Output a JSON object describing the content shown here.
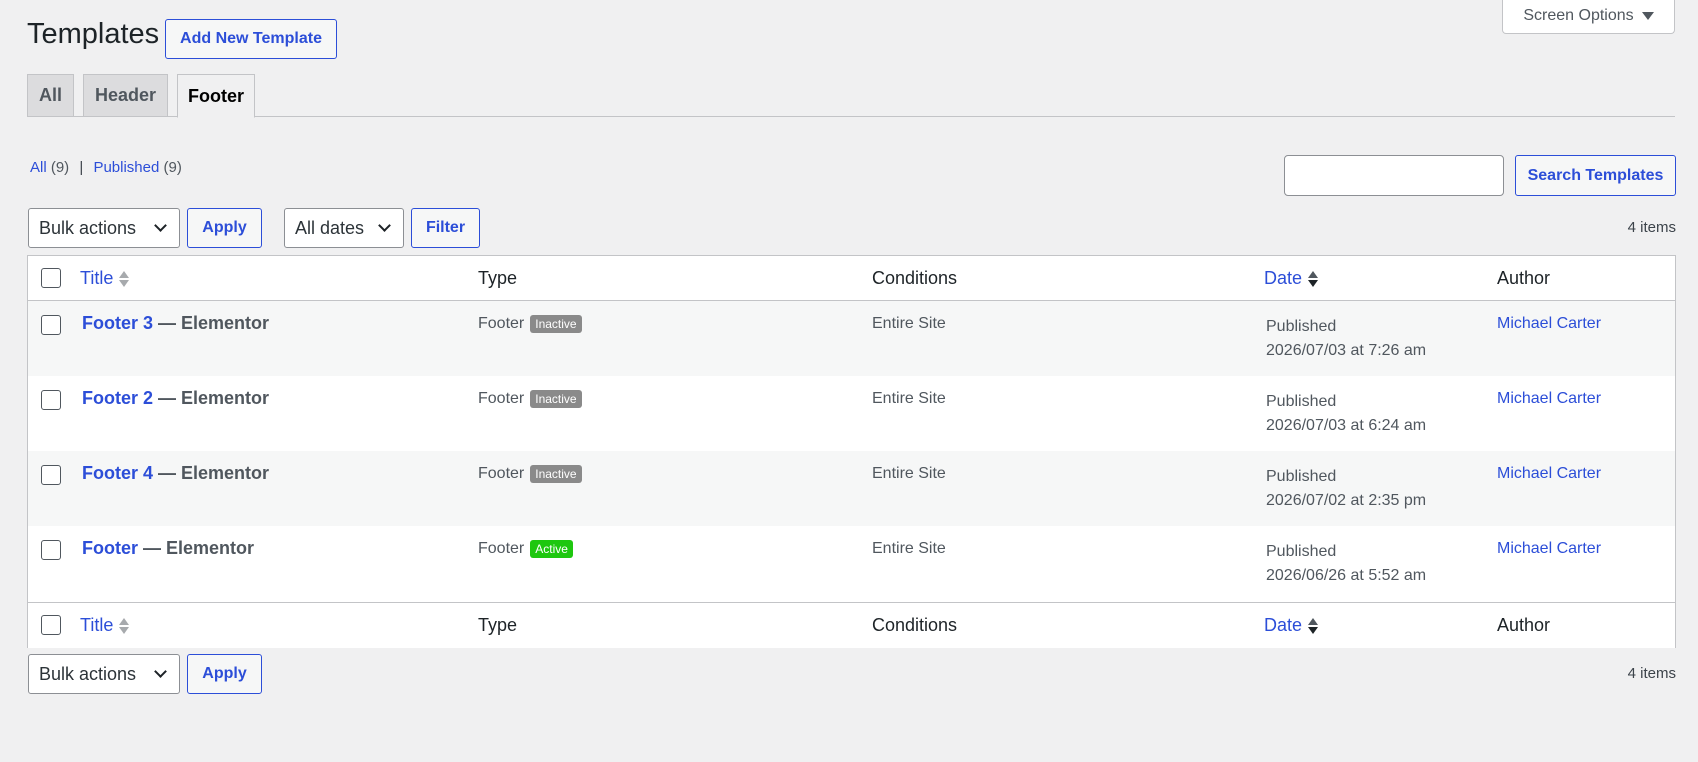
{
  "header": {
    "title": "Templates",
    "add_new_label": "Add New Template",
    "screen_options_label": "Screen Options"
  },
  "tabs": [
    {
      "label": "All",
      "active": false
    },
    {
      "label": "Header",
      "active": false
    },
    {
      "label": "Footer",
      "active": true
    }
  ],
  "views": {
    "all_label": "All",
    "all_count": "(9)",
    "published_label": "Published",
    "published_count": "(9)",
    "separator": "|"
  },
  "search": {
    "value": "",
    "button_label": "Search Templates"
  },
  "toolbar_top": {
    "bulk_actions": "Bulk actions",
    "apply_label": "Apply",
    "date_filter": "All dates",
    "filter_label": "Filter",
    "items_count": "4 items"
  },
  "toolbar_bottom": {
    "bulk_actions": "Bulk actions",
    "apply_label": "Apply",
    "items_count": "4 items"
  },
  "columns": {
    "title": "Title",
    "type": "Type",
    "conditions": "Conditions",
    "date": "Date",
    "author": "Author"
  },
  "rows": [
    {
      "title": "Footer 3",
      "suffix": " — Elementor",
      "type": "Footer",
      "status": "Inactive",
      "conditions": "Entire Site",
      "date_status": "Published",
      "date": "2026/07/03 at 7:26 am",
      "author": "Michael Carter"
    },
    {
      "title": "Footer 2",
      "suffix": " — Elementor",
      "type": "Footer",
      "status": "Inactive",
      "conditions": "Entire Site",
      "date_status": "Published",
      "date": "2026/07/03 at 6:24 am",
      "author": "Michael Carter"
    },
    {
      "title": "Footer 4",
      "suffix": " — Elementor",
      "type": "Footer",
      "status": "Inactive",
      "conditions": "Entire Site",
      "date_status": "Published",
      "date": "2026/07/02 at 2:35 pm",
      "author": "Michael Carter"
    },
    {
      "title": "Footer",
      "suffix": " — Elementor",
      "type": "Footer",
      "status": "Active",
      "conditions": "Entire Site",
      "date_status": "Published",
      "date": "2026/06/26 at 5:52 am",
      "author": "Michael Carter"
    }
  ],
  "colors": {
    "accent": "#2c4ed8",
    "badge_inactive": "#8a8a8a",
    "badge_active": "#1ec70f",
    "background": "#f0f0f1"
  }
}
